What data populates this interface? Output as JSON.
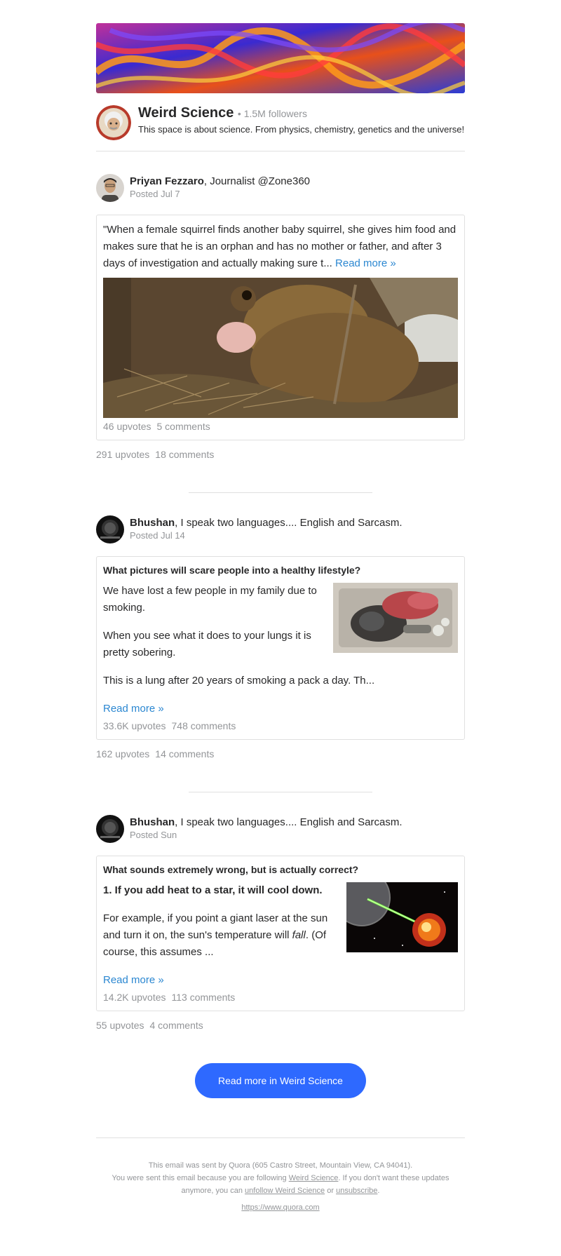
{
  "space": {
    "name": "Weird Science",
    "followers": "• 1.5M followers",
    "description": "This space is about science. From physics, chemistry, genetics and the universe!"
  },
  "posts": [
    {
      "author": "Priyan Fezzaro",
      "credential": ", Journalist @Zone360",
      "posted": "Posted Jul 7",
      "excerpt": "\"When a female squirrel finds another baby squirrel, she gives him food and makes sure that he is an orphan and has no mother or father, and after 3 days of investigation and actually making sure t...",
      "read_more": "Read more »",
      "card_upvotes": "46 upvotes",
      "card_comments": "5 comments",
      "upvotes": "291 upvotes",
      "comments": "18 comments"
    },
    {
      "author": "Bhushan",
      "credential": ", I speak two languages.... English and Sarcasm.",
      "posted": "Posted Jul 14",
      "question": "What pictures will scare people into a healthy lifestyle?",
      "para1": "We have lost a few people in my family due to smoking.",
      "para2": "When you see what it does to your lungs it is pretty sobering.",
      "para3": "This is a lung after 20 years of smoking a pack a day. Th...",
      "read_more": "Read more »",
      "card_upvotes": "33.6K upvotes",
      "card_comments": "748 comments",
      "upvotes": "162 upvotes",
      "comments": "14 comments"
    },
    {
      "author": "Bhushan",
      "credential": ", I speak two languages.... English and Sarcasm.",
      "posted": "Posted Sun",
      "question": "What sounds extremely wrong, but is actually correct?",
      "heading": "1. If you add heat to a star, it will cool down.",
      "para_pre": "For example, if you point a giant laser at the sun and turn it on, the sun's temperature will ",
      "para_em": "fall",
      "para_post": ". (Of course, this assumes ...",
      "read_more": "Read more »",
      "card_upvotes": "14.2K upvotes",
      "card_comments": "113 comments",
      "upvotes": "55 upvotes",
      "comments": "4 comments"
    }
  ],
  "cta_label": "Read more in Weird Science",
  "footer": {
    "line1": "This email was sent by Quora (605 Castro Street, Mountain View, CA 94041).",
    "line2_pre": "You were sent this email because you are following ",
    "line2_link": "Weird Science",
    "line2_post": ". If you don't want these updates anymore, you can ",
    "unfollow": "unfollow Weird Science",
    "or": " or ",
    "unsubscribe": "unsubscribe",
    "period": ".",
    "url": "https://www.quora.com"
  },
  "colors": {
    "accent": "#2e69ff",
    "link": "#2b87d1",
    "muted": "#939598",
    "text": "#282829",
    "border": "#e0e0e0"
  }
}
